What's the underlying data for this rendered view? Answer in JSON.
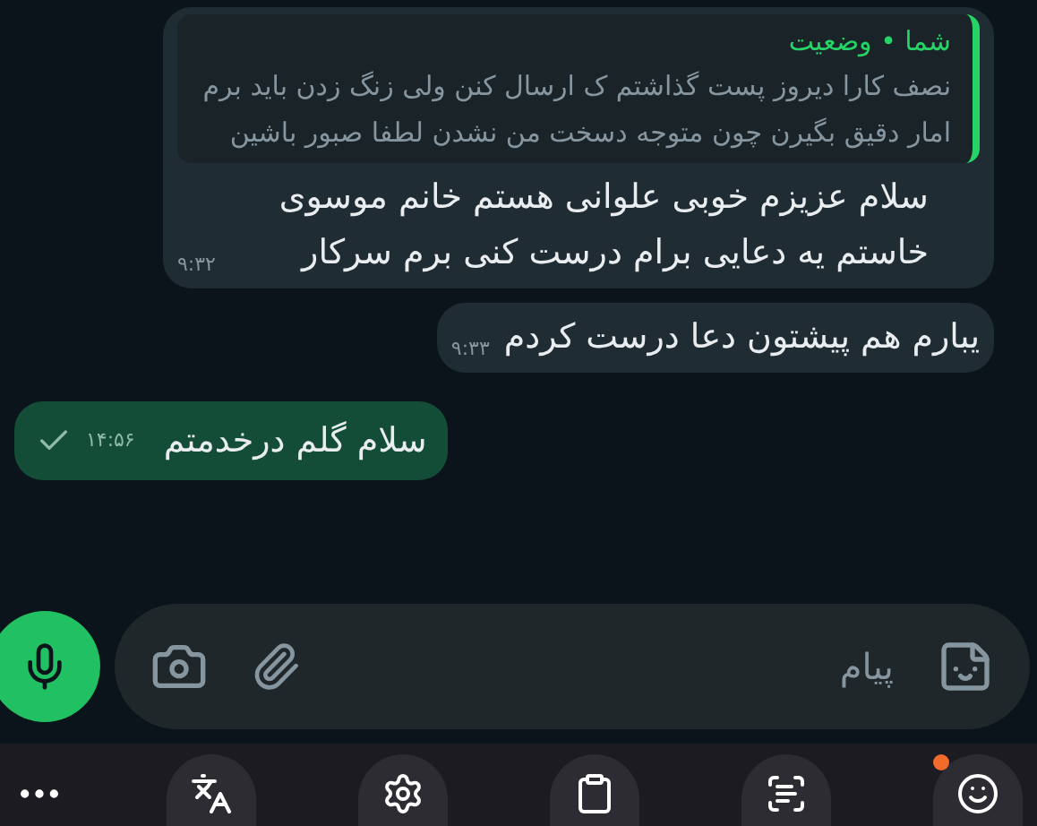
{
  "messages": [
    {
      "kind": "incoming",
      "quote": {
        "author": "شما • وضعیت",
        "text": "نصف کارا دیروز پست گذاشتم ک ارسال کنن ولی زنگ زدن باید برم امار دقیق بگیرن چون متوجه دسخت من نشدن لطفا صبور باشین"
      },
      "text": "سلام عزیزم خوبی علوانی هستم خانم موسوی خاستم یه دعایی برام درست کنی برم سرکار",
      "time": "۹:۳۲"
    },
    {
      "kind": "incoming",
      "text": "یبارم هم پیشتون دعا درست کردم",
      "time": "۹:۳۳"
    },
    {
      "kind": "outgoing",
      "text": "سلام گلم درخدمتم",
      "time": "۱۴:۵۶",
      "delivered": false
    }
  ],
  "composer": {
    "placeholder": "پیام"
  },
  "keyboard_toolbar": [
    {
      "kind": "more"
    },
    {
      "kind": "translate",
      "badge": false
    },
    {
      "kind": "settings",
      "badge": false
    },
    {
      "kind": "clipboard",
      "badge": false
    },
    {
      "kind": "ocr",
      "badge": false
    },
    {
      "kind": "emoji",
      "badge": true
    }
  ]
}
